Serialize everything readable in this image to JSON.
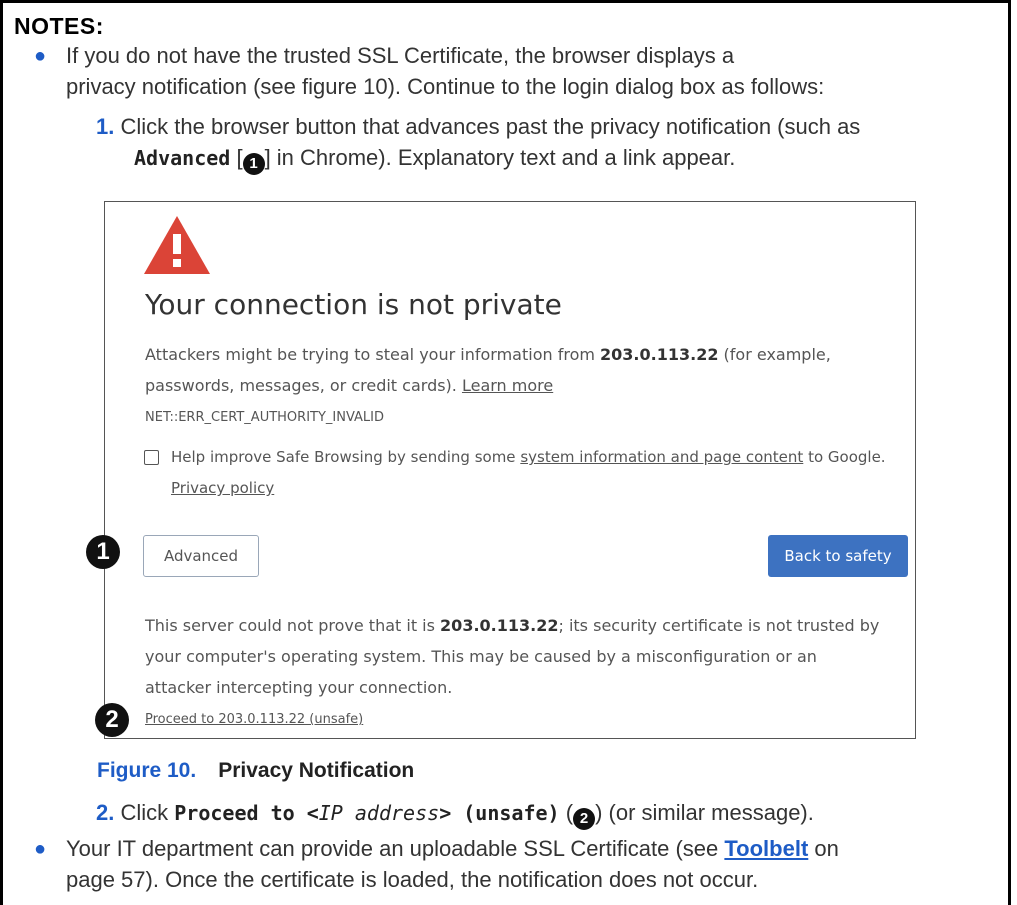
{
  "notes": {
    "title": "NOTES:",
    "bullet1": {
      "line1": "If you do not have the trusted SSL Certificate, the browser displays a",
      "line2": "privacy notification (see figure 10). Continue to the login dialog box as follows:"
    },
    "step1": {
      "number": "1.",
      "line1": "Click the browser button that advances past the privacy notification (such as",
      "advanced_label": "Advanced",
      "mid_text_a": " [",
      "callout_glyph": "1",
      "mid_text_b": "] in Chrome). Explanatory text and a link appear."
    },
    "step2": {
      "number": "2.",
      "click": "Click ",
      "proceed_bold": "Proceed to <",
      "ip_italic": "IP address",
      "proceed_end": "> (unsafe)",
      "paren_open": " (",
      "callout_glyph": "2",
      "tail": ") (or similar message)."
    },
    "bullet2": {
      "line1_a": "Your IT department can provide an uploadable SSL Certificate (see ",
      "toolbelt_link": "Toolbelt",
      "line1_b": " on",
      "line2": "page 57). Once the certificate is loaded, the notification does not occur."
    },
    "figure": {
      "number": "Figure 10.",
      "title": "Privacy Notification"
    }
  },
  "screenshot": {
    "heading": "Your connection is not private",
    "desc_a": "Attackers might be trying to steal your information from ",
    "ip": "203.0.113.22",
    "desc_b": " (for example,",
    "desc_line2": "passwords, messages, or credit cards). ",
    "learn_more": "Learn more",
    "error_code": "NET::ERR_CERT_AUTHORITY_INVALID",
    "safe_browsing_a": "Help improve Safe Browsing by sending some ",
    "safe_browsing_link": "system information and page content",
    "safe_browsing_b": " to Google.",
    "privacy_policy": "Privacy policy",
    "advanced_button": "Advanced",
    "back_button": "Back to safety",
    "server_a": "This server could not prove that it is ",
    "server_ip": "203.0.113.22",
    "server_b": "; its security certificate is not trusted by",
    "server_line2": "your computer's operating system. This may be caused by a misconfiguration or an",
    "server_line3": "attacker intercepting your connection.",
    "proceed_link": "Proceed to 203.0.113.22 (unsafe)",
    "callout1": "1",
    "callout2": "2",
    "warning_color": "#db4437",
    "button_color": "#3d72c1"
  }
}
